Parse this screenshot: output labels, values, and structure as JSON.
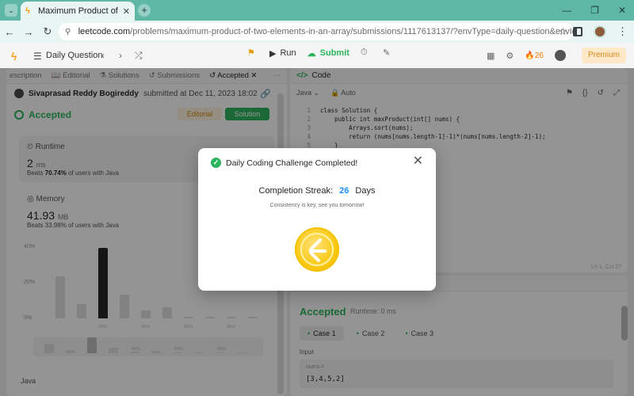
{
  "browser": {
    "tab_title": "Maximum Product of Two Elem",
    "url_host": "leetcode.com",
    "url_path": "/problems/maximum-product-of-two-elements-in-an-array/submissions/1117613137/?envType=daily-question&envId=2023-12-12"
  },
  "topbar": {
    "daily_label": "Daily Question",
    "run_label": "Run",
    "submit_label": "Submit",
    "streak_count": "26",
    "premium_label": "Premium"
  },
  "left_tabs": {
    "description": "escription",
    "editorial": "Editorial",
    "solutions": "Solutions",
    "submissions": "Submissions",
    "accepted": "Accepted"
  },
  "submission": {
    "author": "Sivaprasad Reddy Bogireddy",
    "submitted_text": "submitted at Dec 11, 2023 18:02",
    "status": "Accepted",
    "editorial_btn": "Editorial",
    "solution_btn": "Solution"
  },
  "runtime": {
    "label": "Runtime",
    "value": "2",
    "unit": "ms",
    "beats_prefix": "Beats",
    "beats_pct": "70.74%",
    "beats_suffix": "of users with Java"
  },
  "memory": {
    "label": "Memory",
    "value": "41.93",
    "unit": "MB",
    "beats_text": "Beats 33.98% of users with Java"
  },
  "chart_data": {
    "type": "bar",
    "yticks": [
      "40%",
      "20%",
      "0%"
    ],
    "xticks": [
      "2ms",
      "4ms",
      "6ms",
      "8ms"
    ],
    "values": [
      26,
      9,
      44,
      15,
      5,
      7,
      1,
      1,
      1,
      1
    ],
    "highlight_index": 2,
    "ylim": [
      0,
      40
    ],
    "minimap_xticks": [
      "2ms",
      "4ms",
      "6ms",
      "8ms"
    ]
  },
  "language_label": "Java",
  "code_panel": {
    "title": "Code",
    "language": "Java",
    "mode": "Auto",
    "cursor": "Ln 1, Col 27",
    "lines": [
      {
        "n": "1",
        "text": "class Solution {"
      },
      {
        "n": "2",
        "text": "    public int maxProduct(int[] nums) {"
      },
      {
        "n": "3",
        "text": "        Arrays.sort(nums);"
      },
      {
        "n": "4",
        "text": "        return (nums[nums.length-1]-1)*(nums[nums.length-2]-1);"
      },
      {
        "n": "5",
        "text": "    }"
      }
    ]
  },
  "result": {
    "status": "Accepted",
    "runtime": "Runtime: 0 ms",
    "cases": [
      "Case 1",
      "Case 2",
      "Case 3"
    ],
    "input_label": "Input",
    "input_var": "nums =",
    "input_value": "[3,4,5,2]"
  },
  "modal": {
    "title": "Daily Coding Challenge Completed!",
    "streak_label": "Completion Streak:",
    "streak_value": "26",
    "streak_unit": "Days",
    "subtitle": "Consistency is key, see you tomorrow!"
  },
  "colors": {
    "accent_green": "#2db55d",
    "streak_blue": "#1a90ff",
    "coin_gold": "#f9c80e"
  }
}
